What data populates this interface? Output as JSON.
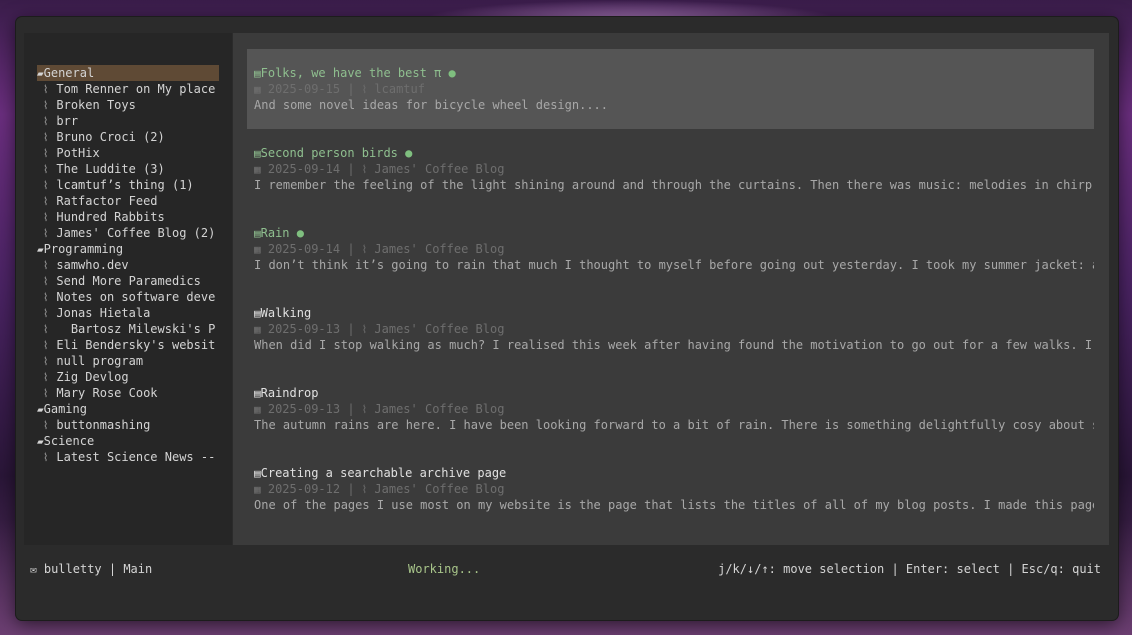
{
  "app": {
    "name": "bulletty",
    "view": "Main"
  },
  "status": {
    "left_icon": "mailbox-icon",
    "app_label": "bulletty | Main",
    "working": "Working...",
    "help": "j/k/↓/↑: move selection | Enter: select | Esc/q: quit"
  },
  "sidebar": {
    "categories": [
      {
        "name": "General",
        "selected": true,
        "feeds": [
          "Tom Renner on My place",
          "Broken Toys",
          "brr",
          "Bruno Croci (2)",
          "PotHix",
          "The Luddite (3)",
          "lcamtuf’s thing (1)",
          "Ratfactor Feed",
          "Hundred Rabbits",
          "James' Coffee Blog (2)"
        ]
      },
      {
        "name": "Programming",
        "selected": false,
        "feeds": [
          "samwho.dev",
          "Send More Paramedics",
          "Notes on software deve",
          "Jonas Hietala",
          "  Bartosz Milewski's P",
          "Eli Bendersky's websit",
          "null program",
          "Zig Devlog",
          "Mary Rose Cook"
        ]
      },
      {
        "name": "Gaming",
        "selected": false,
        "feeds": [
          "buttonmashing"
        ]
      },
      {
        "name": "Science",
        "selected": false,
        "feeds": [
          "Latest Science News --"
        ]
      }
    ]
  },
  "entries": [
    {
      "title": "Folks, we have the best π",
      "unread": true,
      "date": "2025-09-15",
      "source": "lcamtuf",
      "excerpt": "And some novel ideas for bicycle wheel design....",
      "selected": true
    },
    {
      "title": "Second person birds",
      "unread": true,
      "date": "2025-09-14",
      "source": "James' Coffee Blog",
      "excerpt": "I remember the feeling of the light shining around and through the curtains. Then there was music: melodies in chirp. I",
      "selected": false
    },
    {
      "title": "Rain",
      "unread": true,
      "date": "2025-09-14",
      "source": "James' Coffee Blog",
      "excerpt": "I don’t think it’s going to rain that much I thought to myself before going out yesterday. I took my summer jacket: a li",
      "selected": false
    },
    {
      "title": "Walking",
      "unread": false,
      "date": "2025-09-13",
      "source": "James' Coffee Blog",
      "excerpt": "When did I stop walking as much? I realised this week after having found the motivation to go out for a few walks. I kne",
      "selected": false
    },
    {
      "title": "Raindrop",
      "unread": false,
      "date": "2025-09-13",
      "source": "James' Coffee Blog",
      "excerpt": "The autumn rains are here. I have been looking forward to a bit of rain. There is something delightfully cosy about sitt",
      "selected": false
    },
    {
      "title": "Creating a searchable archive page",
      "unread": false,
      "date": "2025-09-12",
      "source": "James' Coffee Blog",
      "excerpt": "One of the pages I use most on my website is the page that lists the titles of all of my blog posts. I made this page fo",
      "selected": false
    }
  ],
  "icons": {
    "folder": "folder-open-icon",
    "feed": "rss-icon",
    "article": "newspaper-icon",
    "date": "calendar-icon",
    "unread": "unread-dot-icon"
  },
  "colors": {
    "unread_title": "#8fbf8f",
    "selected_category": "#5f4a35",
    "selected_entry": "#555555",
    "working": "#a8c58a"
  }
}
